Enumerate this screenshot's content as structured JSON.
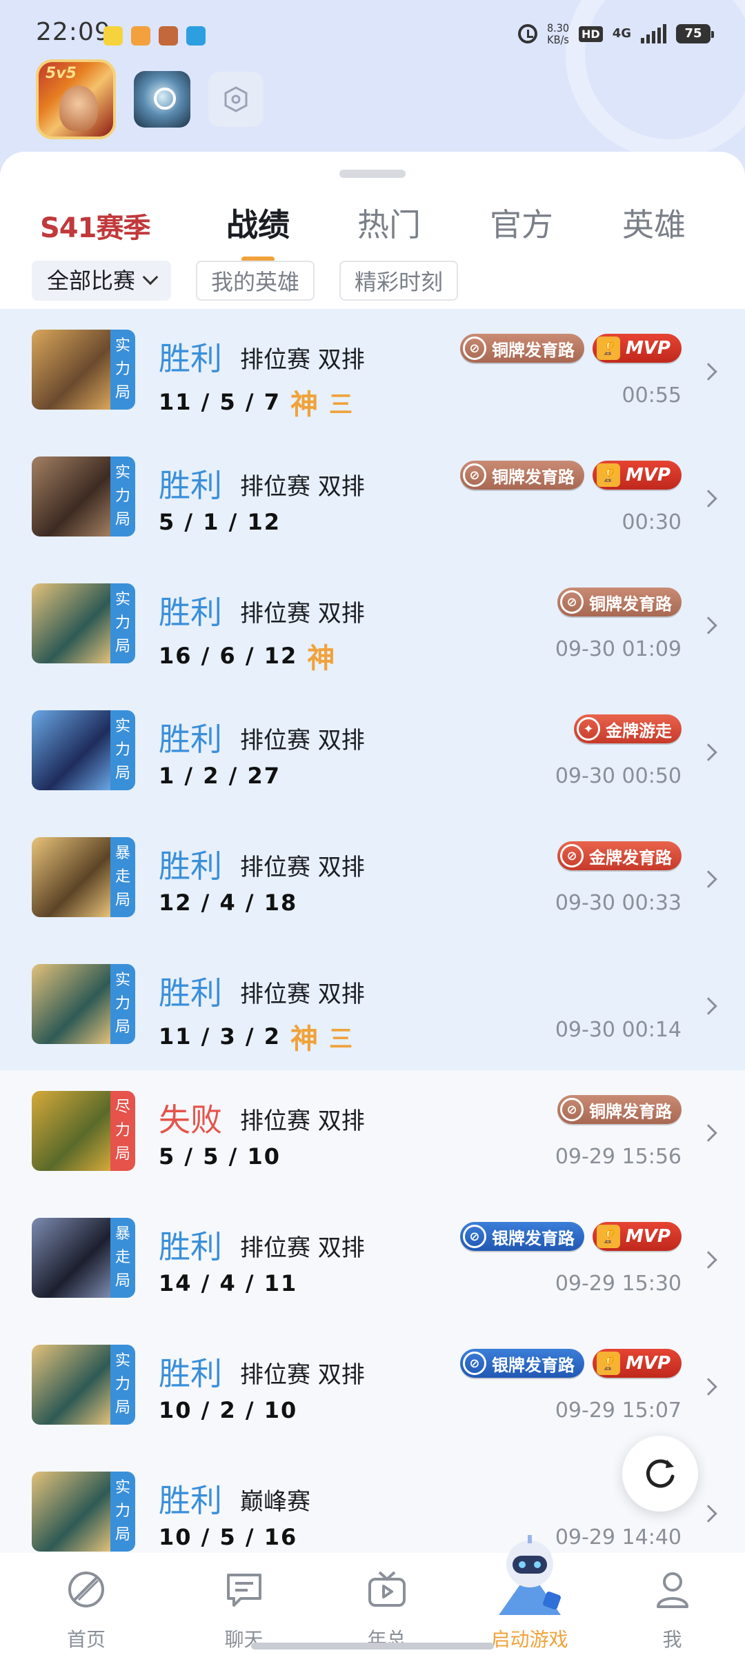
{
  "status_bar": {
    "time": "22:09",
    "net_speed_value": "8.30",
    "net_speed_unit": "KB/s",
    "hd": "HD",
    "network": "4G",
    "battery": "75"
  },
  "season_label": "S41赛季",
  "tabs": [
    "战绩",
    "热门",
    "官方",
    "英雄"
  ],
  "active_tab": "战绩",
  "filters": {
    "all_matches": "全部比赛",
    "my_heroes": "我的英雄",
    "highlights": "精彩时刻"
  },
  "matches": [
    {
      "result": "胜利",
      "mode": "排位赛 双排",
      "kda": "11 / 5 / 7",
      "god": "神",
      "triple": "三",
      "tag": [
        "实",
        "力",
        "局"
      ],
      "badges": [
        {
          "kind": "bronze",
          "text": "铜牌发育路"
        },
        {
          "kind": "mvp",
          "text": "MVP"
        }
      ],
      "time": "00:55"
    },
    {
      "result": "胜利",
      "mode": "排位赛 双排",
      "kda": "5 / 1 / 12",
      "god": "",
      "triple": "",
      "tag": [
        "实",
        "力",
        "局"
      ],
      "badges": [
        {
          "kind": "bronze",
          "text": "铜牌发育路"
        },
        {
          "kind": "mvp",
          "text": "MVP"
        }
      ],
      "time": "00:30"
    },
    {
      "result": "胜利",
      "mode": "排位赛 双排",
      "kda": "16 / 6 / 12",
      "god": "神",
      "triple": "",
      "tag": [
        "实",
        "力",
        "局"
      ],
      "badges": [
        {
          "kind": "bronze",
          "text": "铜牌发育路"
        }
      ],
      "time": "09-30 01:09"
    },
    {
      "result": "胜利",
      "mode": "排位赛 双排",
      "kda": "1 / 2 / 27",
      "god": "",
      "triple": "",
      "tag": [
        "实",
        "力",
        "局"
      ],
      "badges": [
        {
          "kind": "gold",
          "text": "金牌游走"
        }
      ],
      "time": "09-30 00:50"
    },
    {
      "result": "胜利",
      "mode": "排位赛 双排",
      "kda": "12 / 4 / 18",
      "god": "",
      "triple": "",
      "tag": [
        "暴",
        "走",
        "局"
      ],
      "badges": [
        {
          "kind": "gold",
          "text": "金牌发育路"
        }
      ],
      "time": "09-30 00:33"
    },
    {
      "result": "胜利",
      "mode": "排位赛 双排",
      "kda": "11 / 3 / 2",
      "god": "神",
      "triple": "三",
      "tag": [
        "实",
        "力",
        "局"
      ],
      "badges": [],
      "time": "09-30 00:14"
    },
    {
      "result": "失败",
      "mode": "排位赛 双排",
      "kda": "5 / 5 / 10",
      "god": "",
      "triple": "",
      "tag": [
        "尽",
        "力",
        "局"
      ],
      "badges": [
        {
          "kind": "bronze",
          "text": "铜牌发育路"
        }
      ],
      "time": "09-29 15:56"
    },
    {
      "result": "胜利",
      "mode": "排位赛 双排",
      "kda": "14 / 4 / 11",
      "god": "",
      "triple": "",
      "tag": [
        "暴",
        "走",
        "局"
      ],
      "badges": [
        {
          "kind": "silver",
          "text": "银牌发育路"
        },
        {
          "kind": "mvp",
          "text": "MVP"
        }
      ],
      "time": "09-29 15:30"
    },
    {
      "result": "胜利",
      "mode": "排位赛 双排",
      "kda": "10 / 2 / 10",
      "god": "",
      "triple": "",
      "tag": [
        "实",
        "力",
        "局"
      ],
      "badges": [
        {
          "kind": "silver",
          "text": "银牌发育路"
        },
        {
          "kind": "mvp",
          "text": "MVP"
        }
      ],
      "time": "09-29 15:07"
    },
    {
      "result": "胜利",
      "mode": "巅峰赛",
      "kda": "10 / 5 / 16",
      "god": "",
      "triple": "",
      "tag": [
        "实",
        "力",
        "局"
      ],
      "badges": [],
      "time": "09-29 14:40"
    }
  ],
  "bottom_nav": [
    {
      "label": "首页",
      "icon": "home-icon"
    },
    {
      "label": "聊天",
      "icon": "chat-icon"
    },
    {
      "label": "年总",
      "icon": "tv-icon"
    },
    {
      "label": "启动游戏",
      "icon": "mascot-icon"
    },
    {
      "label": "我",
      "icon": "person-icon"
    }
  ],
  "colors": {
    "win": "#3a8fd9",
    "loss": "#e5534b",
    "accent": "#f0a23a",
    "season": "#c0393b"
  }
}
